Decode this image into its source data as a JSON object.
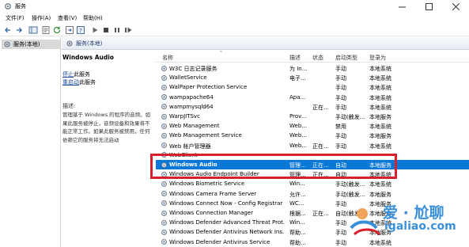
{
  "window": {
    "title": "服务"
  },
  "menu": [
    "文件(F)",
    "操作(A)",
    "查看(V)",
    "帮助(H)"
  ],
  "tree": {
    "root_label": "服务(本地)"
  },
  "header": {
    "title": "服务(本地)"
  },
  "detail": {
    "service_name": "Windows Audio",
    "stop_link": "停止",
    "stop_suffix": "此服务",
    "restart_link": "重启动",
    "restart_suffix": "此服务",
    "desc_label": "描述:",
    "desc_text": "管理基于 Windows 的程序的音频。如果此服务被停止，音频设备和效果将不能正常工作。如果此服务被禁用，任何依赖它的服务将无法启动"
  },
  "columns": {
    "name": "名称",
    "desc": "描述",
    "status": "状态",
    "startup": "启动类型",
    "logon": "登录为"
  },
  "services": [
    {
      "name": "W3C 日志记录服务",
      "desc": "为 In...",
      "status": "",
      "startup": "手动",
      "logon": "本地系统"
    },
    {
      "name": "WalletService",
      "desc": "电子...",
      "status": "",
      "startup": "手动",
      "logon": "本地系统"
    },
    {
      "name": "WalPaper Protection Service",
      "desc": "",
      "status": "",
      "startup": "手动",
      "logon": "本地系统"
    },
    {
      "name": "wampapache64",
      "desc": "Apa...",
      "status": "",
      "startup": "手动",
      "logon": "本地系统"
    },
    {
      "name": "wampmysqld64",
      "desc": "",
      "status": "正在...",
      "startup": "手动",
      "logon": "本地系统"
    },
    {
      "name": "WarpJITSvc",
      "desc": "Prov...",
      "status": "",
      "startup": "手动(触发...",
      "logon": "本地服务"
    },
    {
      "name": "Web Management",
      "desc": "Web...",
      "status": "",
      "startup": "禁用",
      "logon": "本地系统"
    },
    {
      "name": "Web Management Service",
      "desc": "Web...",
      "status": "",
      "startup": "手动",
      "logon": "本地服务"
    },
    {
      "name": "Web 帐户管理器",
      "desc": "Web...",
      "status": "正在...",
      "startup": "手动",
      "logon": "本地系统"
    },
    {
      "name": "WebClient",
      "desc": "",
      "status": "",
      "startup": "",
      "logon": ""
    },
    {
      "name": "Windows Audio",
      "desc": "管理...",
      "status": "正在...",
      "startup": "自动",
      "logon": "本地服务",
      "selected": true
    },
    {
      "name": "Windows Audio Endpoint Builder",
      "desc": "管理...",
      "status": "正在...",
      "startup": "自动",
      "logon": "本地系统"
    },
    {
      "name": "Windows Biometric Service",
      "desc": "Win...",
      "status": "",
      "startup": "手动(触发...",
      "logon": "本地系统"
    },
    {
      "name": "Windows Camera Frame Server",
      "desc": "允许...",
      "status": "",
      "startup": "手动(触发...",
      "logon": "本地服务"
    },
    {
      "name": "Windows Connect Now - Config Registrar",
      "desc": "WC...",
      "status": "",
      "startup": "手动",
      "logon": "本地服务"
    },
    {
      "name": "Windows Connection Manager",
      "desc": "根据...",
      "status": "正在...",
      "startup": "自动(触发...",
      "logon": "本地服务"
    },
    {
      "name": "Windows Defender Advanced Threat Prot...",
      "desc": "Win...",
      "status": "",
      "startup": "手动",
      "logon": "本地系统"
    },
    {
      "name": "Windows Defender Antivirus Network Ins...",
      "desc": "帮助...",
      "status": "",
      "startup": "手动",
      "logon": "本地服务"
    },
    {
      "name": "Windows Defender Antivirus Service",
      "desc": "帮助...",
      "status": "",
      "startup": "手动",
      "logon": "本地系统"
    }
  ],
  "watermark": {
    "text": "爱 · 尬聊",
    "url": "igaliao.com"
  },
  "colors": {
    "selection": "#0a78d7",
    "highlight_box": "#d6202e",
    "link": "#1a4fa0"
  }
}
